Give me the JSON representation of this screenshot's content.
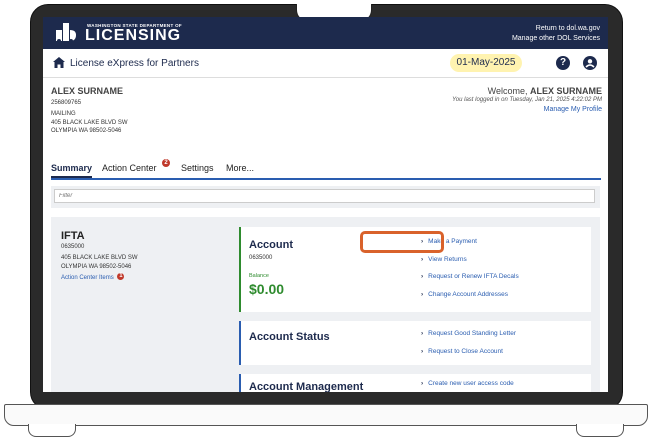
{
  "header": {
    "dept_line": "WASHINGTON STATE DEPARTMENT OF",
    "logo_word": "LICENSING",
    "link_return": "Return to dol.wa.gov",
    "link_manage": "Manage other DOL Services"
  },
  "appbar": {
    "title": "License eXpress for Partners",
    "date": "01-May-2025",
    "help_glyph": "?"
  },
  "profile": {
    "name": "ALEX SURNAME",
    "id": "256809765",
    "addr_type": "MAILING",
    "addr1": "405 BLACK LAKE BLVD SW",
    "addr2": "OLYMPIA WA 98502-5046"
  },
  "welcome": {
    "prefix": "Welcome, ",
    "name": "ALEX SURNAME",
    "last_login": "You last logged in on Tuesday, Jan 21, 2025 4:22:02 PM",
    "manage_profile": "Manage My Profile"
  },
  "tabs": {
    "summary": "Summary",
    "action_center": "Action Center",
    "action_center_badge": "2",
    "settings": "Settings",
    "more": "More..."
  },
  "filter": {
    "placeholder": "Filter"
  },
  "ifta": {
    "title": "IFTA",
    "number": "0635000",
    "addr1": "405 BLACK LAKE BLVD SW",
    "addr2": "OLYMPIA WA 98502-5046",
    "action_items": "Action Center Items",
    "action_items_badge": "1"
  },
  "account_card": {
    "title": "Account",
    "number": "0635000",
    "balance_label": "Balance",
    "balance": "$0.00",
    "actions": [
      "Make a Payment",
      "View Returns",
      "Request or Renew IFTA Decals",
      "Change Account Addresses"
    ]
  },
  "status_card": {
    "title": "Account Status",
    "actions": [
      "Request Good Standing Letter",
      "Request to Close Account"
    ]
  },
  "management_card": {
    "title": "Account Management",
    "actions": [
      "Create new user access code"
    ]
  },
  "colors": {
    "navy": "#1d2a4d",
    "link": "#2a5db0",
    "balance_green": "#2e8b2e",
    "highlight": "#d9622b",
    "date_chip": "#fff3b0"
  }
}
